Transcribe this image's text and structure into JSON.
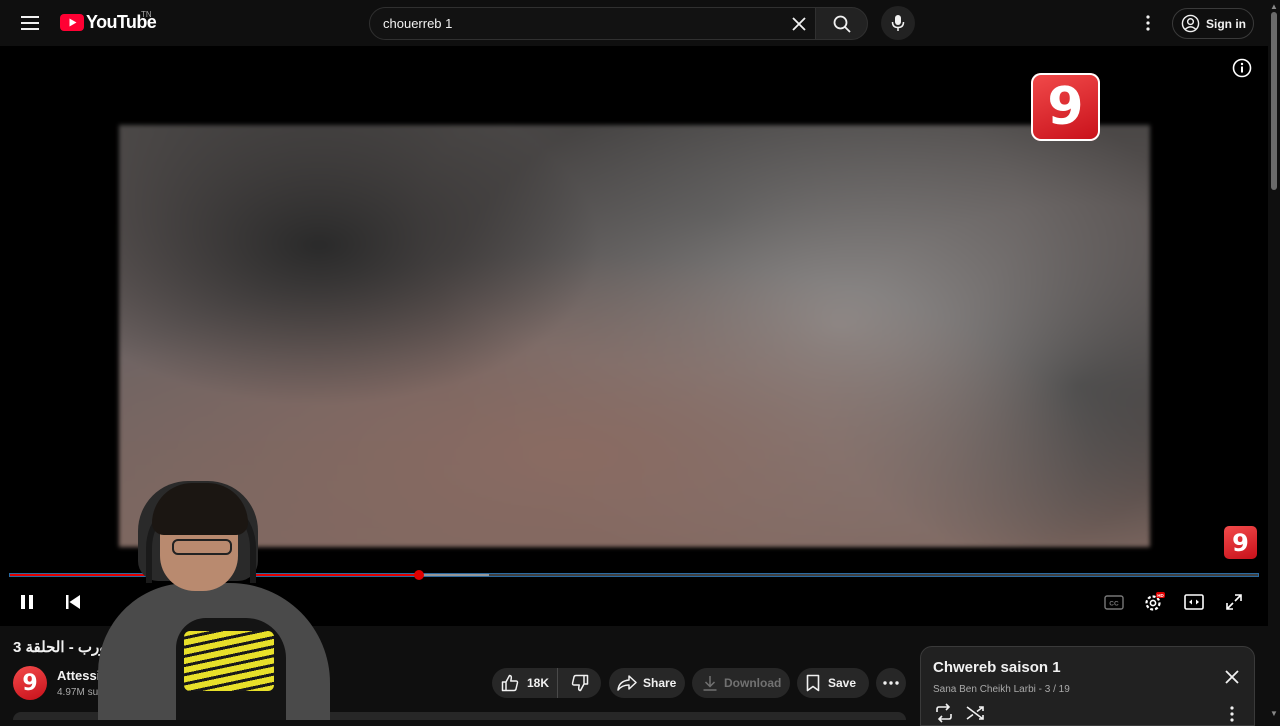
{
  "topbar": {
    "logo_text": "YouTube",
    "country_code": "TN",
    "search_value": "chouerreb 1",
    "signin_label": "Sign in"
  },
  "player": {
    "channel_logo_digit": "9",
    "progress_played_fraction": 0.328,
    "progress_buffered_fraction": 0.384
  },
  "video": {
    "title": "شورب - الحلقة 3",
    "channel_name": "Attessi",
    "subscribers": "4.97M su",
    "channel_avatar_digit": "9"
  },
  "actions": {
    "like_count": "18K",
    "share_label": "Share",
    "download_label": "Download",
    "save_label": "Save"
  },
  "playlist": {
    "title": "Chwereb saison 1",
    "subtitle": "Sana Ben Cheikh Larbi - 3 / 19"
  },
  "colors": {
    "accent": "#e00000",
    "background": "#0f0f0f",
    "channel_brand": "#d8141f"
  }
}
